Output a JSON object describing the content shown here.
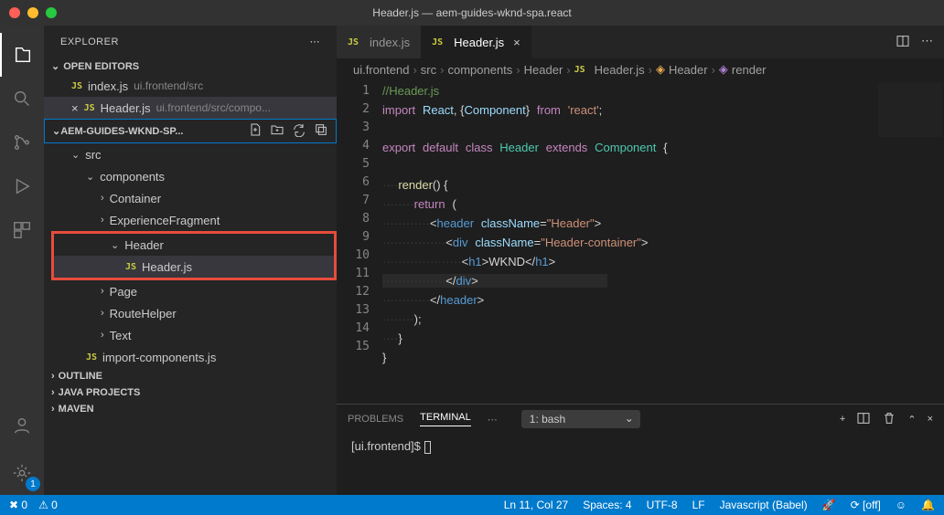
{
  "window": {
    "title": "Header.js — aem-guides-wknd-spa.react"
  },
  "sidebar": {
    "title": "EXPLORER",
    "openEditors": {
      "label": "OPEN EDITORS"
    },
    "editors": [
      {
        "name": "index.js",
        "path": "ui.frontend/src"
      },
      {
        "name": "Header.js",
        "path": "ui.frontend/src/compo..."
      }
    ],
    "project": {
      "label": "AEM-GUIDES-WKND-SP..."
    },
    "tree": {
      "src": "src",
      "components": "components",
      "container": "Container",
      "experienceFragment": "ExperienceFragment",
      "header": "Header",
      "headerjs": "Header.js",
      "page": "Page",
      "routeHelper": "RouteHelper",
      "text": "Text",
      "importComponents": "import-components.js"
    },
    "outline": "OUTLINE",
    "javaProjects": "JAVA PROJECTS",
    "maven": "MAVEN"
  },
  "tabs": [
    {
      "name": "index.js"
    },
    {
      "name": "Header.js"
    }
  ],
  "breadcrumb": {
    "p1": "ui.frontend",
    "p2": "src",
    "p3": "components",
    "p4": "Header",
    "p5": "Header.js",
    "p6": "Header",
    "p7": "render"
  },
  "code": {
    "l1": "//Header.js",
    "l2_import": "import",
    "l2_react": "React",
    "l2_comp": "Component",
    "l2_from": "from",
    "l2_str": "'react'",
    "l4_exp": "export",
    "l4_def": "default",
    "l4_class": "class",
    "l4_h": "Header",
    "l4_ext": "extends",
    "l4_c": "Component",
    "l6_render": "render",
    "l7_return": "return",
    "l8_header": "header",
    "l8_cn": "className",
    "l8_val": "\"Header\"",
    "l9_div": "div",
    "l9_cn": "className",
    "l9_val": "\"Header-container\"",
    "l10_h1": "h1",
    "l10_txt": "WKND",
    "l10_h1c": "h1",
    "l11_div": "div",
    "l12_header": "header"
  },
  "panel": {
    "problems": "PROBLEMS",
    "terminal": "TERMINAL",
    "dropdown": "1: bash",
    "prompt": "[ui.frontend]$ "
  },
  "status": {
    "errors": "0",
    "warnings": "0",
    "ln": "Ln 11, Col 27",
    "spaces": "Spaces: 4",
    "enc": "UTF-8",
    "eol": "LF",
    "lang": "Javascript (Babel)",
    "off": "[off]"
  }
}
